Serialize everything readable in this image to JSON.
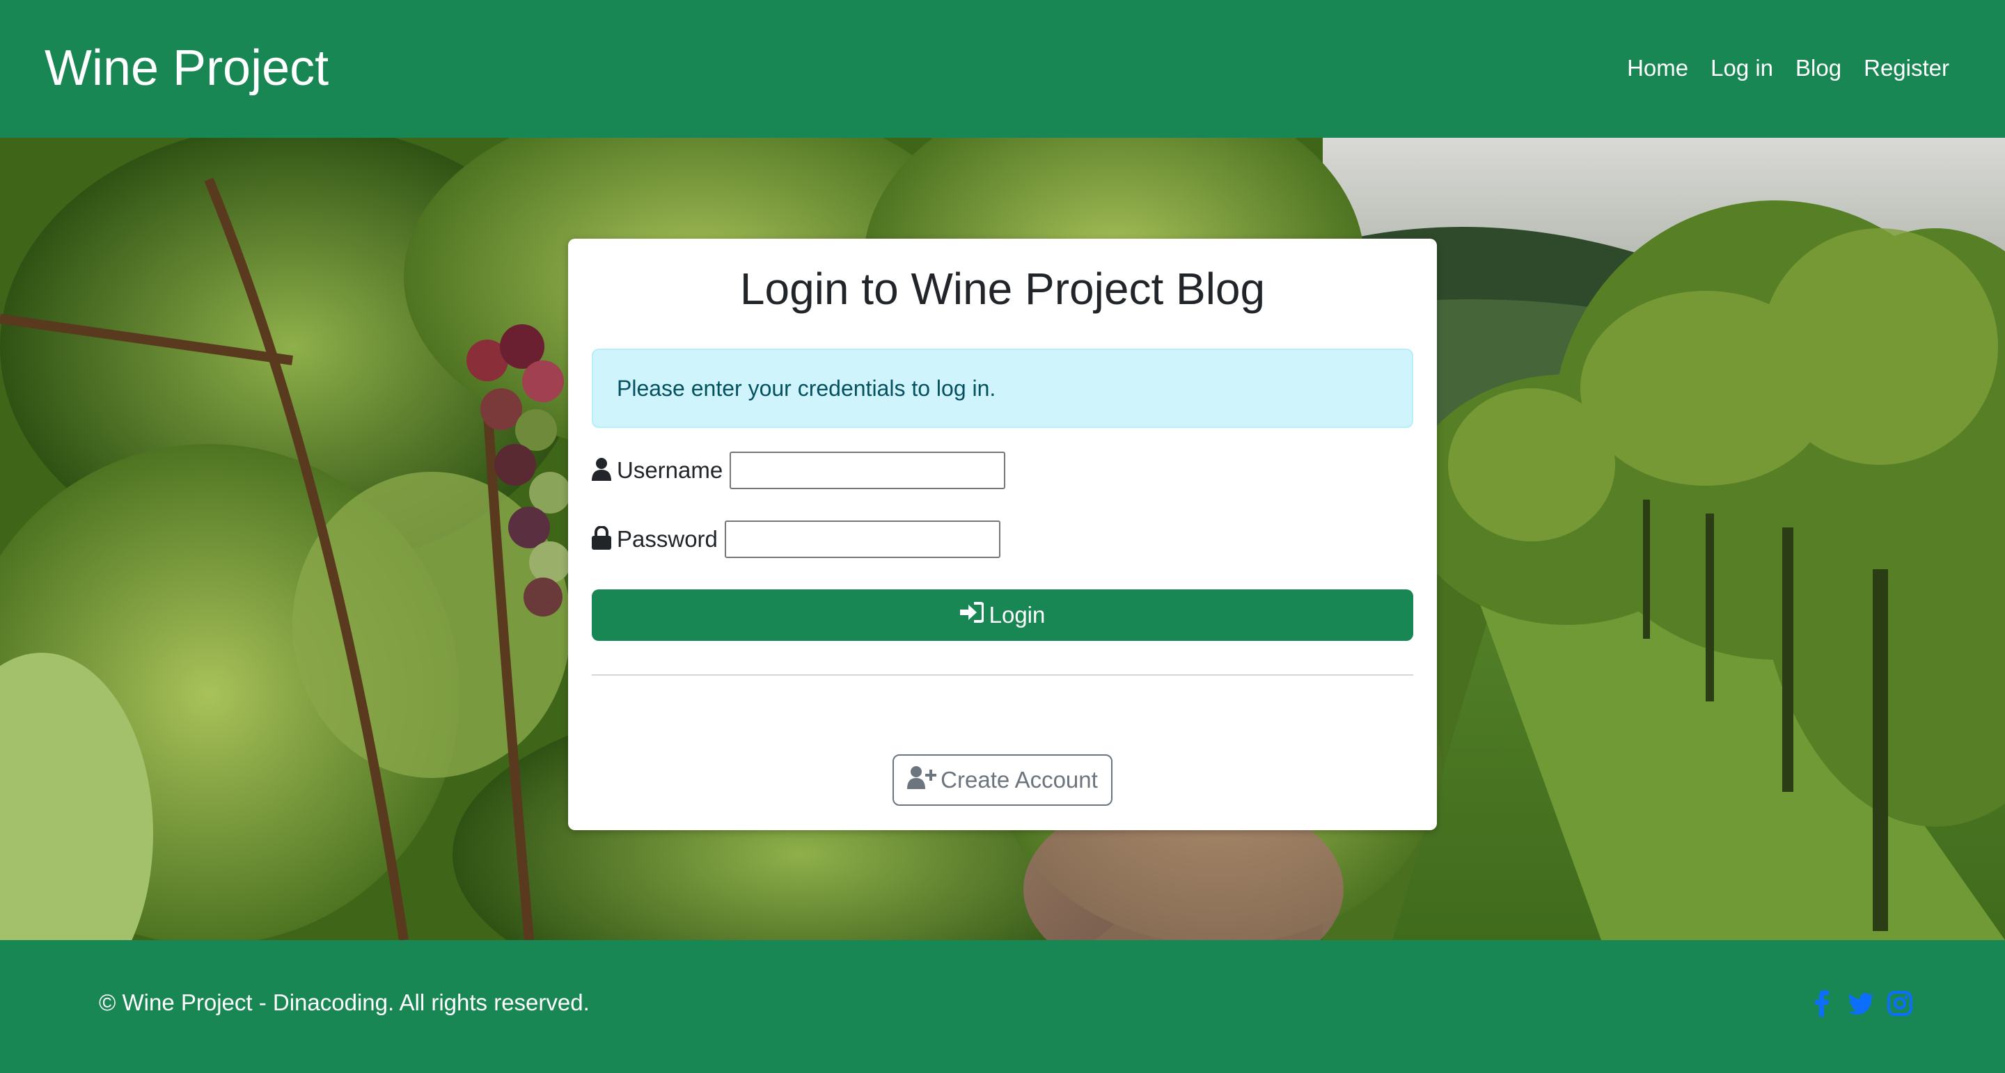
{
  "header": {
    "brand": "Wine Project",
    "nav": [
      {
        "label": "Home"
      },
      {
        "label": "Log in"
      },
      {
        "label": "Blog"
      },
      {
        "label": "Register"
      }
    ]
  },
  "login": {
    "title": "Login to Wine Project Blog",
    "alert": "Please enter your credentials to log in.",
    "username_label": "Username",
    "username_value": "",
    "password_label": "Password",
    "password_value": "",
    "login_button": "Login",
    "create_account_button": "Create Account",
    "icons": {
      "username": "user-icon",
      "password": "lock-icon",
      "login": "sign-in-icon",
      "create_account": "user-plus-icon"
    }
  },
  "footer": {
    "copyright": "© Wine Project - Dinacoding. All rights reserved.",
    "social": [
      "facebook-icon",
      "twitter-icon",
      "instagram-icon"
    ]
  },
  "colors": {
    "primary": "#198754",
    "alert_bg": "#cff4fc",
    "alert_text": "#055160",
    "social": "#0d6efd"
  }
}
